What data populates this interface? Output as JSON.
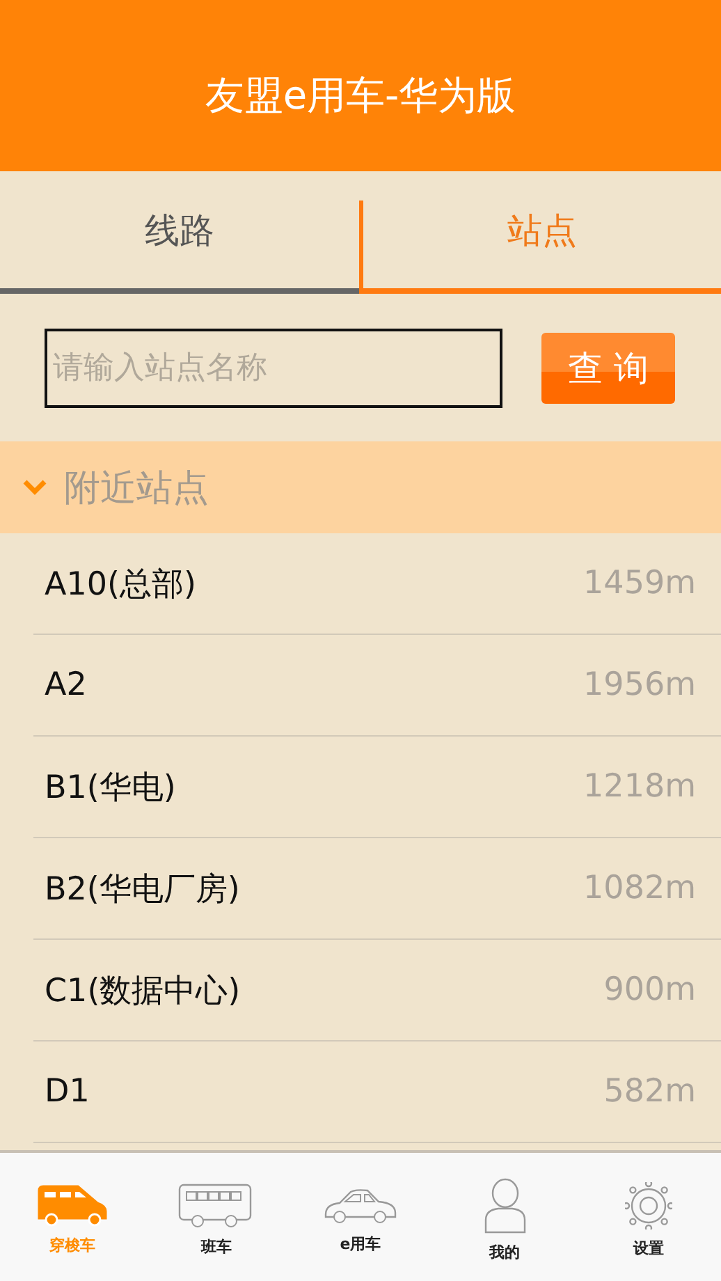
{
  "header": {
    "title": "友盟e用车-华为版"
  },
  "tabs": [
    {
      "label": "线路",
      "selected": false
    },
    {
      "label": "站点",
      "selected": true
    }
  ],
  "search": {
    "placeholder": "请输入站点名称",
    "button": "查 询"
  },
  "section": {
    "title": "附近站点",
    "expanded": true
  },
  "stations": [
    {
      "name": "A10(总部)",
      "distance": "1459m"
    },
    {
      "name": "A2",
      "distance": "1956m"
    },
    {
      "name": "B1(华电)",
      "distance": "1218m"
    },
    {
      "name": "B2(华电厂房)",
      "distance": "1082m"
    },
    {
      "name": "C1(数据中心)",
      "distance": "900m"
    },
    {
      "name": "D1",
      "distance": "582m"
    }
  ],
  "bottom_nav": [
    {
      "kind": "van",
      "label": "穿梭车",
      "selected": true
    },
    {
      "kind": "bus",
      "label": "班车",
      "selected": false
    },
    {
      "kind": "car",
      "label": "e用车",
      "selected": false
    },
    {
      "kind": "person",
      "label": "我的",
      "selected": false
    },
    {
      "kind": "gear",
      "label": "设置",
      "selected": false
    }
  ]
}
